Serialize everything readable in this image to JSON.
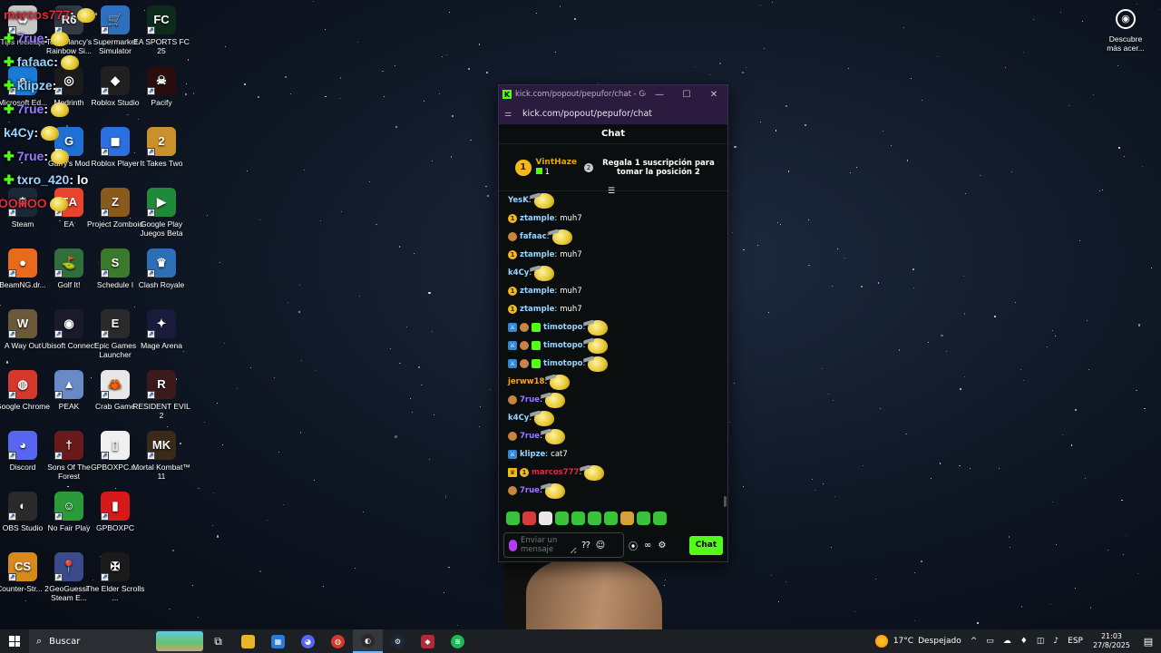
{
  "desktop": {
    "icons": [
      {
        "label": "Tips reciclaje",
        "color": "#c8c8c8",
        "glyph": "♻",
        "col": 0,
        "row": 0
      },
      {
        "label": "Tom Clancy's Rainbow Si...",
        "color": "#333a44",
        "glyph": "R6",
        "col": 1,
        "row": 0
      },
      {
        "label": "Supermarket Simulator",
        "color": "#2e6fbf",
        "glyph": "🛒",
        "col": 2,
        "row": 0
      },
      {
        "label": "EA SPORTS FC 25",
        "color": "#0c2b1a",
        "glyph": "FC",
        "col": 3,
        "row": 0
      },
      {
        "label": "Microsoft Ed...",
        "color": "#1a7bd6",
        "glyph": "e",
        "col": 0,
        "row": 1
      },
      {
        "label": "Modrinth",
        "color": "#1b1b1b",
        "glyph": "◎",
        "col": 1,
        "row": 1
      },
      {
        "label": "Roblox Studio",
        "color": "#202020",
        "glyph": "◆",
        "col": 2,
        "row": 1
      },
      {
        "label": "Pacify",
        "color": "#2a0e0e",
        "glyph": "☠",
        "col": 3,
        "row": 1
      },
      {
        "label": "Garry's Mod",
        "color": "#1f6fd4",
        "glyph": "G",
        "col": 1,
        "row": 2
      },
      {
        "label": "Roblox Player",
        "color": "#2b6fe0",
        "glyph": "◼",
        "col": 2,
        "row": 2
      },
      {
        "label": "It Takes Two",
        "color": "#c8912b",
        "glyph": "2",
        "col": 3,
        "row": 2
      },
      {
        "label": "Steam",
        "color": "#1b2838",
        "glyph": "⚙",
        "col": 0,
        "row": 3
      },
      {
        "label": "EA",
        "color": "#e8432c",
        "glyph": "EA",
        "col": 1,
        "row": 3
      },
      {
        "label": "Project Zomboid",
        "color": "#8a5a1a",
        "glyph": "Z",
        "col": 2,
        "row": 3
      },
      {
        "label": "Google Play Juegos Beta",
        "color": "#1f8a3a",
        "glyph": "▶",
        "col": 3,
        "row": 3
      },
      {
        "label": "BeamNG.dr...",
        "color": "#e86a1a",
        "glyph": "●",
        "col": 0,
        "row": 4
      },
      {
        "label": "Golf It!",
        "color": "#2f6f3a",
        "glyph": "⛳",
        "col": 1,
        "row": 4
      },
      {
        "label": "Schedule I",
        "color": "#3a7a2a",
        "glyph": "S",
        "col": 2,
        "row": 4
      },
      {
        "label": "Clash Royale",
        "color": "#2d6fb6",
        "glyph": "♛",
        "col": 3,
        "row": 4
      },
      {
        "label": "A Way Out",
        "color": "#6a5a3a",
        "glyph": "W",
        "col": 0,
        "row": 5
      },
      {
        "label": "Ubisoft Connect",
        "color": "#1a1a2a",
        "glyph": "◉",
        "col": 1,
        "row": 5
      },
      {
        "label": "Epic Games Launcher",
        "color": "#2a2a2a",
        "glyph": "E",
        "col": 2,
        "row": 5
      },
      {
        "label": "Mage Arena",
        "color": "#1a1a3a",
        "glyph": "✦",
        "col": 3,
        "row": 5
      },
      {
        "label": "Google Chrome",
        "color": "#d6392b",
        "glyph": "◍",
        "col": 0,
        "row": 6
      },
      {
        "label": "PEAK",
        "color": "#6a8ac6",
        "glyph": "▲",
        "col": 1,
        "row": 6
      },
      {
        "label": "Crab Game",
        "color": "#e8e8e8",
        "glyph": "🦀",
        "col": 2,
        "row": 6
      },
      {
        "label": "RESIDENT EVIL 2",
        "color": "#3a1a1a",
        "glyph": "R",
        "col": 3,
        "row": 6
      },
      {
        "label": "Discord",
        "color": "#5865f2",
        "glyph": "◕",
        "col": 0,
        "row": 7
      },
      {
        "label": "Sons Of The Forest",
        "color": "#6a1a1a",
        "glyph": "†",
        "col": 1,
        "row": 7
      },
      {
        "label": "GPBOXPC.r...",
        "color": "#f0f0f0",
        "glyph": "▯",
        "col": 2,
        "row": 7
      },
      {
        "label": "Mortal Kombat™ 11",
        "color": "#3a2a1a",
        "glyph": "MK",
        "col": 3,
        "row": 7
      },
      {
        "label": "OBS Studio",
        "color": "#2a2a2a",
        "glyph": "◐",
        "col": 0,
        "row": 8
      },
      {
        "label": "No Fair Play",
        "color": "#2a9a3a",
        "glyph": "☺",
        "col": 1,
        "row": 8
      },
      {
        "label": "GPBOXPC",
        "color": "#d61a1a",
        "glyph": "▮",
        "col": 2,
        "row": 8
      },
      {
        "label": "Counter-Str... 2",
        "color": "#d68a1a",
        "glyph": "CS",
        "col": 0,
        "row": 9
      },
      {
        "label": "GeoGuessr Steam E...",
        "color": "#3a4a8a",
        "glyph": "📍",
        "col": 1,
        "row": 9
      },
      {
        "label": "The Elder Scrolls ...",
        "color": "#1a1a1a",
        "glyph": "✠",
        "col": 2,
        "row": 9
      }
    ],
    "discover_label": "Descubre más acer..."
  },
  "overlay": [
    {
      "user": "marcos777",
      "color": "#e22b3b",
      "suffix": ":",
      "emote": true,
      "plus": false
    },
    {
      "user": "7rue",
      "color": "#9b7bff",
      "suffix": ":",
      "emote": true,
      "plus": true
    },
    {
      "user": "fafaac",
      "color": "#9ad5ff",
      "suffix": ":",
      "emote": true,
      "plus": true
    },
    {
      "user": "klipze",
      "color": "#9ad5ff",
      "suffix": ":",
      "emote": false,
      "plus": true
    },
    {
      "user": "7rue",
      "color": "#9b7bff",
      "suffix": ":",
      "emote": true,
      "plus": true
    },
    {
      "user": "k4Cy",
      "color": "#9ad5ff",
      "suffix": ":",
      "emote": true,
      "plus": false
    },
    {
      "user": "7rue",
      "color": "#9b7bff",
      "suffix": ":",
      "emote": true,
      "plus": true
    },
    {
      "user": "txro_420",
      "color": "#9ad5ff",
      "suffix": ": lo",
      "emote": false,
      "plus": true
    },
    {
      "user": "OOHOO",
      "color": "#e22b3b",
      "suffix": "",
      "emote": true,
      "plus": false
    }
  ],
  "window": {
    "title": "kick.com/popout/pepufor/chat - Googl...",
    "url": "kick.com/popout/pepufor/chat",
    "chat_title": "Chat",
    "pinned": {
      "rank": "1",
      "user": "VintHaze",
      "count": "1",
      "position_badge": "2",
      "text": "Regala 1 suscripción para tomar la posición 2"
    },
    "messages": [
      {
        "user": "YesK",
        "color": "#9ad5ff",
        "badges": [],
        "text": "",
        "emote": true
      },
      {
        "user": "ztample",
        "color": "#9ad5ff",
        "badges": [
          "coin"
        ],
        "text": "muh7",
        "emote": false
      },
      {
        "user": "fafaac",
        "color": "#9ad5ff",
        "badges": [
          "bronze"
        ],
        "text": "",
        "emote": true
      },
      {
        "user": "ztample",
        "color": "#9ad5ff",
        "badges": [
          "coin"
        ],
        "text": "muh7",
        "emote": false
      },
      {
        "user": "k4Cy",
        "color": "#9ad5ff",
        "badges": [],
        "text": "",
        "emote": true
      },
      {
        "user": "ztample",
        "color": "#9ad5ff",
        "badges": [
          "coin"
        ],
        "text": "muh7",
        "emote": false
      },
      {
        "user": "ztample",
        "color": "#9ad5ff",
        "badges": [
          "coin"
        ],
        "text": "muh7",
        "emote": false
      },
      {
        "user": "timotopo",
        "color": "#9ad5ff",
        "badges": [
          "sword",
          "bronze",
          "gift"
        ],
        "text": "",
        "emote": true
      },
      {
        "user": "timotopo",
        "color": "#9ad5ff",
        "badges": [
          "sword",
          "bronze",
          "gift"
        ],
        "text": "",
        "emote": true
      },
      {
        "user": "timotopo",
        "color": "#9ad5ff",
        "badges": [
          "sword",
          "bronze",
          "gift"
        ],
        "text": "",
        "emote": true
      },
      {
        "user": "jerww18",
        "color": "#f5a623",
        "badges": [],
        "text": "",
        "emote": true
      },
      {
        "user": "7rue",
        "color": "#9b7bff",
        "badges": [
          "bronze"
        ],
        "text": "",
        "emote": true
      },
      {
        "user": "k4Cy",
        "color": "#9ad5ff",
        "badges": [],
        "text": "",
        "emote": true
      },
      {
        "user": "7rue",
        "color": "#9b7bff",
        "badges": [
          "bronze"
        ],
        "text": "",
        "emote": true
      },
      {
        "user": "klipze",
        "color": "#9ad5ff",
        "badges": [
          "sword"
        ],
        "text": "cat7",
        "emote": false
      },
      {
        "user": "marcos777",
        "color": "#e22b3b",
        "badges": [
          "crown",
          "coin"
        ],
        "text": "",
        "emote": true
      },
      {
        "user": "7rue",
        "color": "#9b7bff",
        "badges": [
          "bronze"
        ],
        "text": "",
        "emote": true
      }
    ],
    "emote_bar": [
      "#3ac23a",
      "#d63a3a",
      "#e8e8e8",
      "#3ac23a",
      "#3ac23a",
      "#3ac23a",
      "#3ac23a",
      "#d6a03a",
      "#3ac23a",
      "#3ac23a"
    ],
    "input_placeholder": "Enviar un mensaje",
    "chat_button": "Chat"
  },
  "taskbar": {
    "search_placeholder": "Buscar",
    "weather_temp": "17°C",
    "weather_text": "Despejado",
    "language": "ESP",
    "time": "21:03",
    "date": "27/8/2025"
  }
}
